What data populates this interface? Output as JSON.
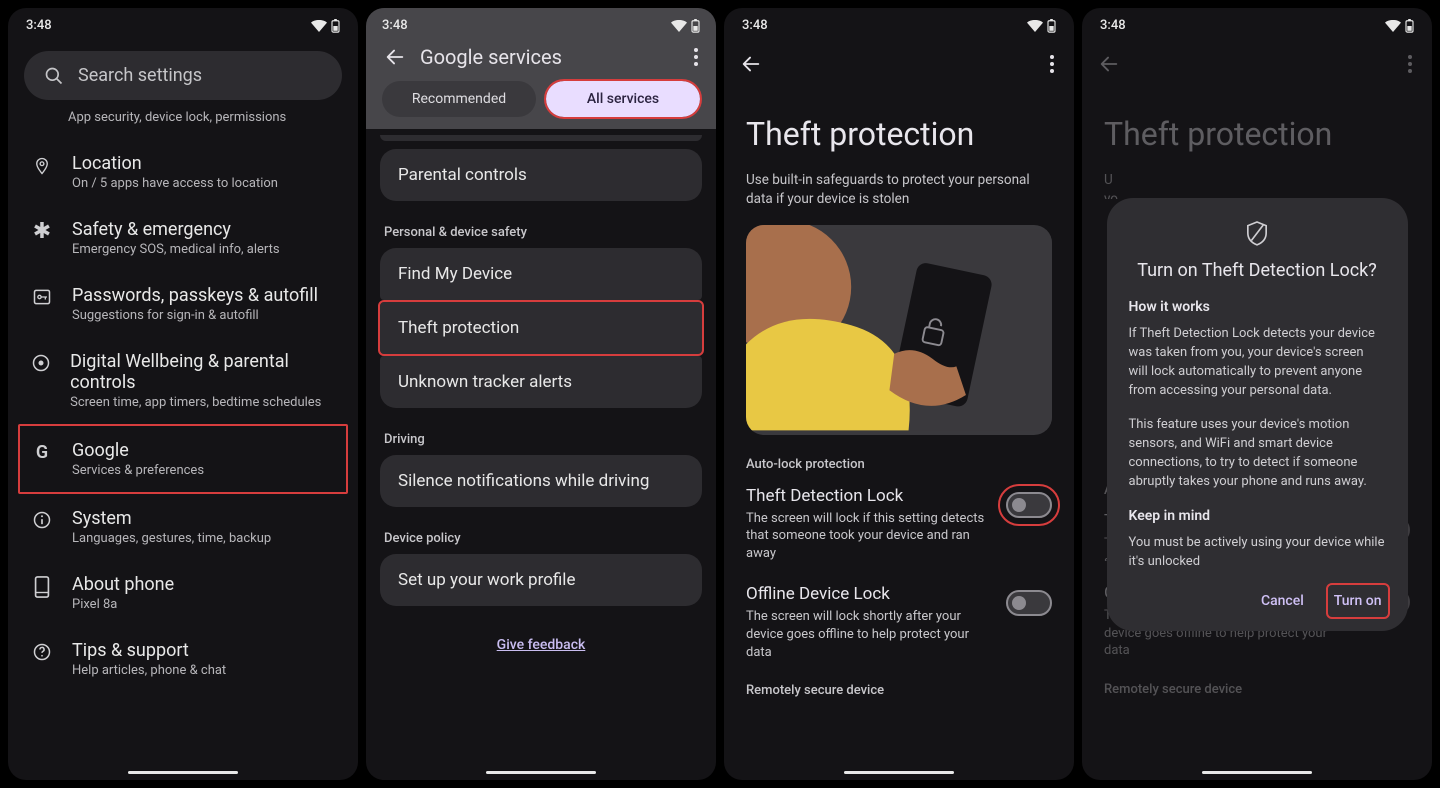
{
  "status": {
    "time": "3:48"
  },
  "screen1": {
    "search_placeholder": "Search settings",
    "top_sub": "App security, device lock, permissions",
    "items": [
      {
        "icon": "location-icon",
        "title": "Location",
        "sub": "On / 5 apps have access to location"
      },
      {
        "icon": "asterisk-icon",
        "title": "Safety & emergency",
        "sub": "Emergency SOS, medical info, alerts"
      },
      {
        "icon": "key-icon",
        "title": "Passwords, passkeys & autofill",
        "sub": "Suggestions for sign-in & autofill"
      },
      {
        "icon": "wellbeing-icon",
        "title": "Digital Wellbeing & parental controls",
        "sub": "Screen time, app timers, bedtime schedules"
      },
      {
        "icon": "google-icon",
        "title": "Google",
        "sub": "Services & preferences",
        "highlight": true
      },
      {
        "icon": "info-icon",
        "title": "System",
        "sub": "Languages, gestures, time, backup"
      },
      {
        "icon": "phone-icon",
        "title": "About phone",
        "sub": "Pixel 8a"
      },
      {
        "icon": "help-icon",
        "title": "Tips & support",
        "sub": "Help articles, phone & chat"
      }
    ]
  },
  "screen2": {
    "title": "Google services",
    "tabs": {
      "recommended": "Recommended",
      "all": "All services"
    },
    "parental": "Parental controls",
    "sec_safety": "Personal & device safety",
    "safety_items": [
      "Find My Device",
      "Theft protection",
      "Unknown tracker alerts"
    ],
    "sec_driving": "Driving",
    "driving_item": "Silence notifications while driving",
    "sec_policy": "Device policy",
    "policy_item": "Set up your work profile",
    "feedback": "Give feedback"
  },
  "screen3": {
    "title": "Theft protection",
    "desc": "Use built-in safeguards to protect your personal data if your device is stolen",
    "sec_auto": "Auto-lock protection",
    "tdl_title": "Theft Detection Lock",
    "tdl_sub": "The screen will lock if this setting detects that someone took your device and ran away",
    "odl_title": "Offline Device Lock",
    "odl_sub": "The screen will lock shortly after your device goes offline to help protect your data",
    "sec_remote": "Remotely secure device"
  },
  "screen4": {
    "title": "Theft protection",
    "peek1": "U",
    "peek2": "yo",
    "sec_auto_short": "A",
    "tdl_short_t": "T",
    "tdl_short_s1": "T",
    "tdl_short_s2": "so",
    "odl_title": "Offline Device Lock",
    "odl_sub": "The screen will lock shortly after your device goes offline to help protect your data",
    "sec_remote": "Remotely secure device",
    "dialog": {
      "title": "Turn on Theft Detection Lock?",
      "h1": "How it works",
      "p1": "If Theft Detection Lock detects your device was taken from you, your device's screen will lock automatically to prevent anyone from accessing your personal data.",
      "p2": "This feature uses your device's motion sensors, and WiFi and smart device connections, to try to detect if someone abruptly takes your phone and runs away.",
      "h2": "Keep in mind",
      "p3": "You must be actively using your device while it's unlocked",
      "cancel": "Cancel",
      "turnon": "Turn on"
    }
  }
}
